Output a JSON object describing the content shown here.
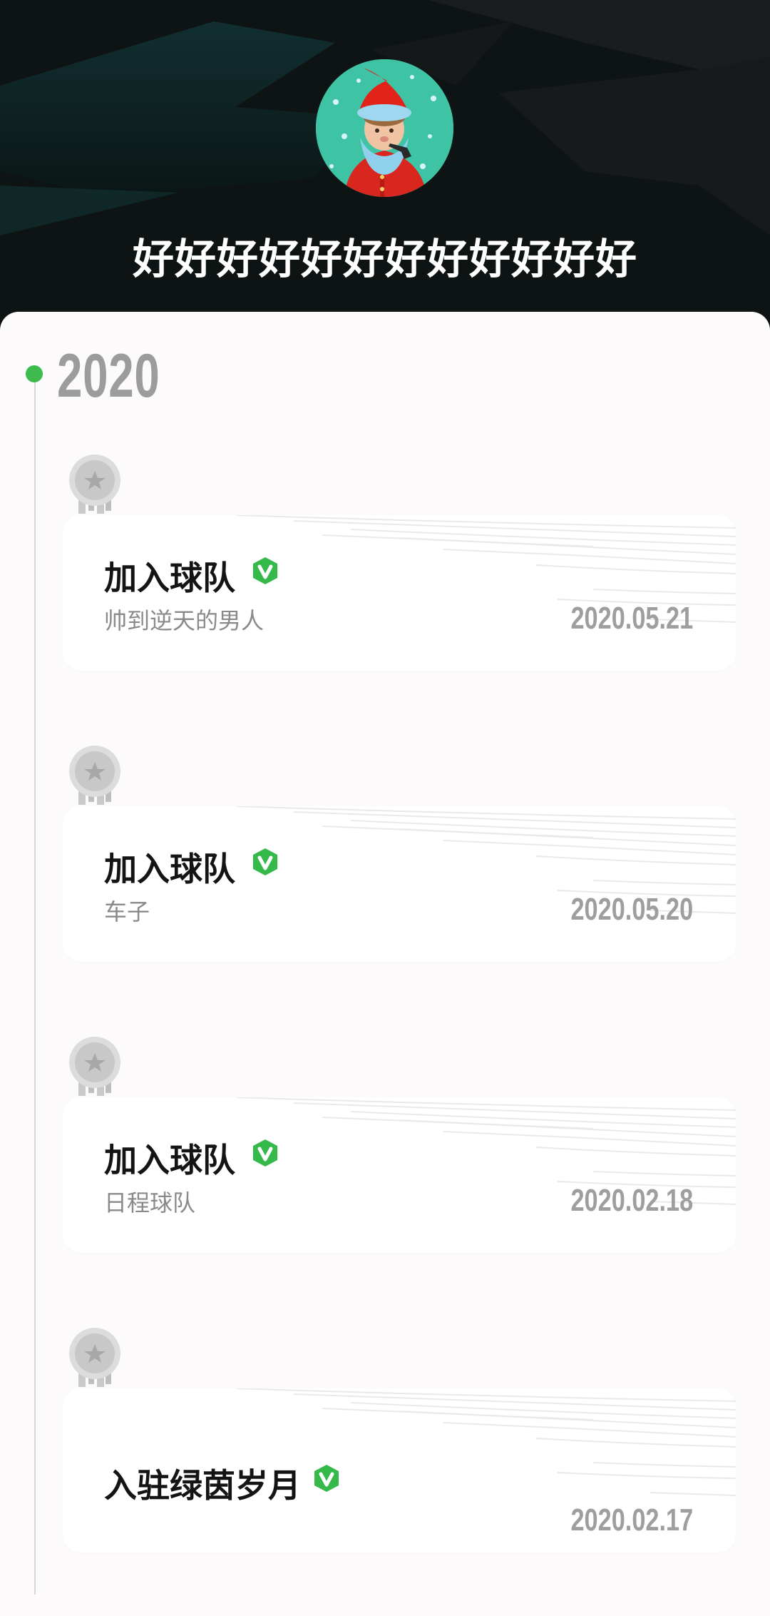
{
  "profile": {
    "nickname": "好好好好好好好好好好好好"
  },
  "timeline": {
    "year": "2020",
    "events": [
      {
        "title": "加入球队",
        "subtitle": "帅到逆天的男人",
        "date": "2020.05.21",
        "verified": true
      },
      {
        "title": "加入球队",
        "subtitle": "车子",
        "date": "2020.05.20",
        "verified": true
      },
      {
        "title": "加入球队",
        "subtitle": "日程球队",
        "date": "2020.02.18",
        "verified": true
      },
      {
        "title": "入驻绿茵岁月",
        "subtitle": "",
        "date": "2020.02.17",
        "verified": true
      }
    ]
  },
  "colors": {
    "header_bg": "#0d1212",
    "accent_green": "#3dbb4c",
    "badge_green": "#35b94a",
    "year_grey": "#9c9c9c",
    "date_grey": "#9e9e9e",
    "page_bg": "#fdfafc"
  },
  "icons": {
    "avatar": "cartoon-santa-avatar",
    "medal": "silver-medal-icon",
    "verified": "verified-v-badge-icon"
  }
}
